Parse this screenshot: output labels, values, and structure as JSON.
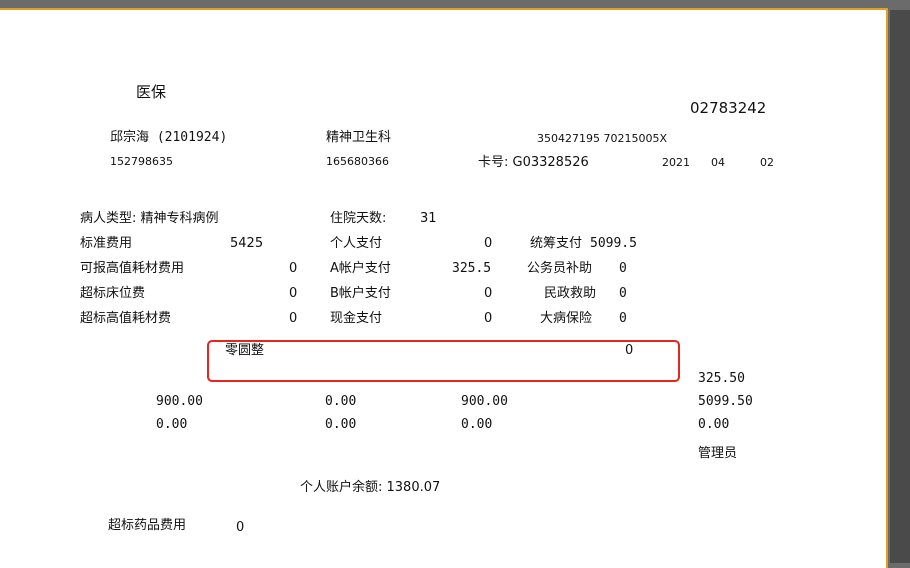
{
  "header": {
    "title": "医保",
    "serial": "02783242"
  },
  "patient": {
    "name_id": "邱宗海 (2101924)",
    "dept": "精神卫生科",
    "id_number": "350427195 70215005X",
    "num1": "152798635",
    "num2": "165680366",
    "card": "卡号: G03328526",
    "year": "2021",
    "month": "04",
    "day": "02"
  },
  "rows": {
    "patient_type": "病人类型: 精神专科病例",
    "days_label": "住院天数:",
    "days_value": "31",
    "std_fee_label": "标准费用",
    "std_fee_value": "5425",
    "personal_pay_label": "个人支付",
    "personal_pay_value": "0",
    "pool_pay_label": "统筹支付",
    "pool_pay_value": "5099.5",
    "high_consum_label": "可报高值耗材费用",
    "high_consum_value": "0",
    "a_account_label": "A帐户支付",
    "a_account_value": "325.5",
    "civil_servant_label": "公务员补助",
    "civil_servant_value": "0",
    "over_bed_label": "超标床位费",
    "over_bed_value": "0",
    "b_account_label": "B帐户支付",
    "b_account_value": "0",
    "civil_aid_label": "民政救助",
    "civil_aid_value": "0",
    "over_consum_label": "超标高值耗材费",
    "over_consum_value": "0",
    "cash_label": "现金支付",
    "cash_value": "0",
    "major_ins_label": "大病保险",
    "major_ins_value": "0"
  },
  "rounding": {
    "label": "零圆整",
    "value": "0"
  },
  "amounts": {
    "r1c4": "325.50",
    "r2c1": "900.00",
    "r2c2": "0.00",
    "r2c3": "900.00",
    "r2c4": "5099.50",
    "r3c1": "0.00",
    "r3c2": "0.00",
    "r3c3": "0.00",
    "r3c4": "0.00",
    "admin": "管理员"
  },
  "balance": "个人账户余额: 1380.07",
  "over_drug": {
    "label": "超标药品费用",
    "value": "0"
  }
}
